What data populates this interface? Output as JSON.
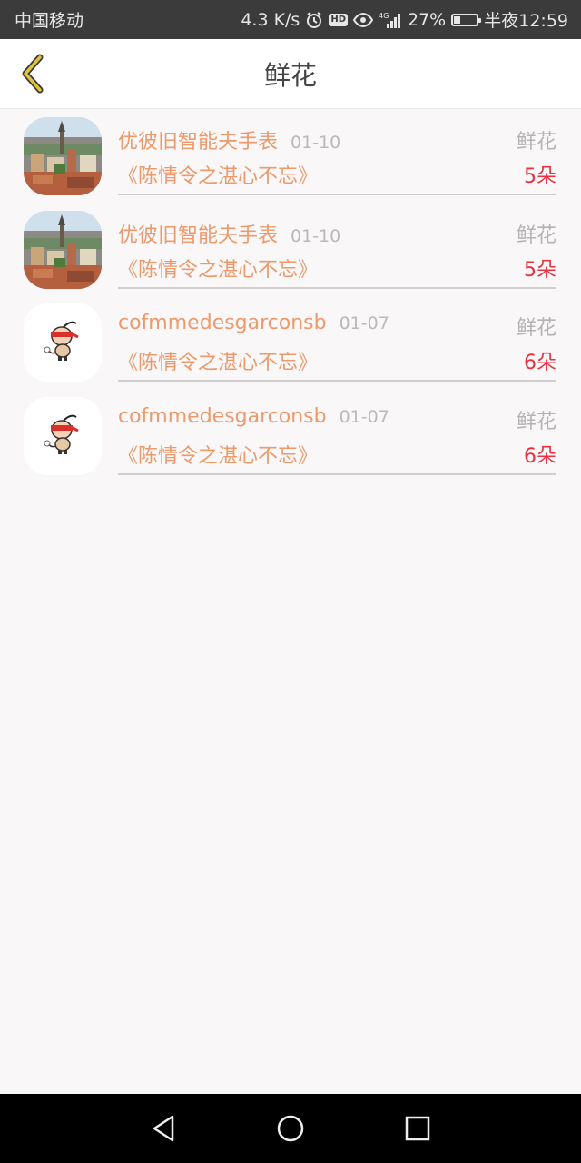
{
  "status_bar": {
    "carrier": "中国移动",
    "speed": "4.3 K/s",
    "hd_badge": "HD",
    "network": "4G",
    "battery_percent": "27%",
    "battery_level": 0.27,
    "time": "半夜12:59"
  },
  "header": {
    "title": "鲜花",
    "back_icon": "chevron-left-icon"
  },
  "list": {
    "items": [
      {
        "name": "优彼旧智能夫手表",
        "date": "01-10",
        "type": "鲜花",
        "work": "《陈情令之湛心不忘》",
        "count": "5朵",
        "avatar": "city-photo"
      },
      {
        "name": "优彼旧智能夫手表",
        "date": "01-10",
        "type": "鲜花",
        "work": "《陈情令之湛心不忘》",
        "count": "5朵",
        "avatar": "city-photo"
      },
      {
        "name": "cofmmedesgarconsb",
        "date": "01-07",
        "type": "鲜花",
        "work": "《陈情令之湛心不忘》",
        "count": "6朵",
        "avatar": "cartoon-boy"
      },
      {
        "name": "cofmmedesgarconsb",
        "date": "01-07",
        "type": "鲜花",
        "work": "《陈情令之湛心不忘》",
        "count": "6朵",
        "avatar": "cartoon-boy"
      }
    ]
  },
  "nav": {
    "back": "triangle-back-icon",
    "home": "circle-home-icon",
    "recents": "square-recents-icon"
  },
  "colors": {
    "accent": "#ec9a6b",
    "count_red": "#e8323f",
    "back_chevron": "#e2c43a"
  }
}
